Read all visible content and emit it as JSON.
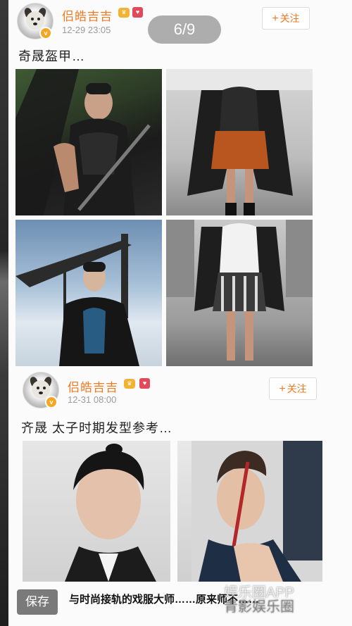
{
  "viewer": {
    "page_indicator": "6/9",
    "save_label": "保存",
    "caption": "与时尚接轨的戏服大师……原来师不……",
    "watermark_line1": "娱乐圈APP",
    "watermark_line2": "青影娱乐圈"
  },
  "posts": [
    {
      "username": "侣皓吉吉",
      "time": "12-29 23:05",
      "follow_label": "关注",
      "text": "奇晟盔甲…"
    },
    {
      "username": "侣皓吉吉",
      "time": "12-31 08:00",
      "follow_label": "关注",
      "text": "齐晟 太子时期发型参考…"
    }
  ],
  "icons": {
    "verified": "verified-badge-icon",
    "vip": "vip-crown-icon",
    "member": "member-badge-icon",
    "plus": "plus-icon"
  },
  "colors": {
    "accent": "#f07a23",
    "vip": "#f2b233",
    "member": "#e2495a"
  }
}
